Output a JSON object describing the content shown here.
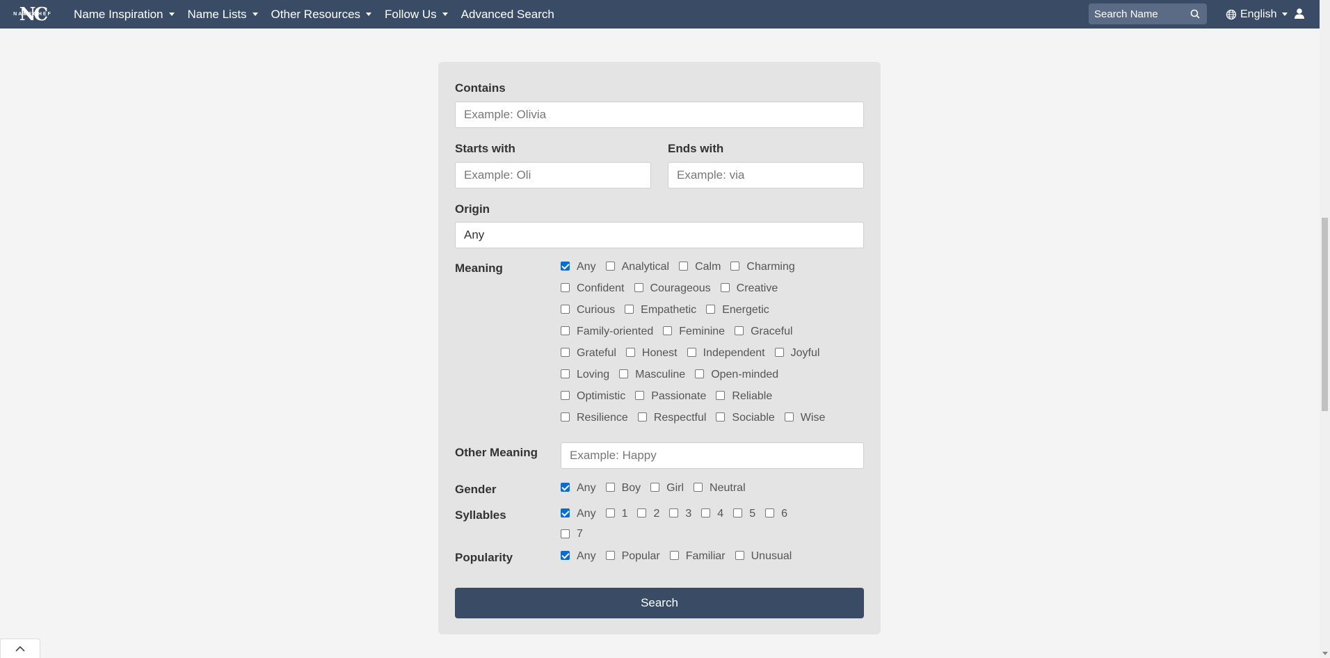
{
  "nav": {
    "logo_mark": "NC",
    "logo_word": "NAMECHEF",
    "items": [
      {
        "label": "Name Inspiration",
        "dropdown": true
      },
      {
        "label": "Name Lists",
        "dropdown": true
      },
      {
        "label": "Other Resources",
        "dropdown": true
      },
      {
        "label": "Follow Us",
        "dropdown": true
      },
      {
        "label": "Advanced Search",
        "dropdown": false
      }
    ],
    "search_placeholder": "Search Name",
    "language": "English",
    "icons": {
      "search": "search-icon",
      "language": "globe-icon",
      "user": "user-icon"
    }
  },
  "form": {
    "contains": {
      "label": "Contains",
      "placeholder": "Example: Olivia"
    },
    "starts_with": {
      "label": "Starts with",
      "placeholder": "Example: Oli"
    },
    "ends_with": {
      "label": "Ends with",
      "placeholder": "Example: via"
    },
    "origin": {
      "label": "Origin",
      "value": "Any"
    },
    "meaning": {
      "label": "Meaning",
      "rows": [
        [
          {
            "label": "Any",
            "checked": true
          },
          {
            "label": "Analytical",
            "checked": false
          },
          {
            "label": "Calm",
            "checked": false
          },
          {
            "label": "Charming",
            "checked": false
          }
        ],
        [
          {
            "label": "Confident",
            "checked": false
          },
          {
            "label": "Courageous",
            "checked": false
          },
          {
            "label": "Creative",
            "checked": false
          }
        ],
        [
          {
            "label": "Curious",
            "checked": false
          },
          {
            "label": "Empathetic",
            "checked": false
          },
          {
            "label": "Energetic",
            "checked": false
          }
        ],
        [
          {
            "label": "Family-oriented",
            "checked": false
          },
          {
            "label": "Feminine",
            "checked": false
          },
          {
            "label": "Graceful",
            "checked": false
          }
        ],
        [
          {
            "label": "Grateful",
            "checked": false
          },
          {
            "label": "Honest",
            "checked": false
          },
          {
            "label": "Independent",
            "checked": false
          },
          {
            "label": "Joyful",
            "checked": false
          }
        ],
        [
          {
            "label": "Loving",
            "checked": false
          },
          {
            "label": "Masculine",
            "checked": false
          },
          {
            "label": "Open-minded",
            "checked": false
          }
        ],
        [
          {
            "label": "Optimistic",
            "checked": false
          },
          {
            "label": "Passionate",
            "checked": false
          },
          {
            "label": "Reliable",
            "checked": false
          }
        ],
        [
          {
            "label": "Resilience",
            "checked": false
          },
          {
            "label": "Respectful",
            "checked": false
          },
          {
            "label": "Sociable",
            "checked": false
          },
          {
            "label": "Wise",
            "checked": false
          }
        ]
      ]
    },
    "other_meaning": {
      "label": "Other Meaning",
      "placeholder": "Example: Happy"
    },
    "gender": {
      "label": "Gender",
      "rows": [
        [
          {
            "label": "Any",
            "checked": true
          },
          {
            "label": "Boy",
            "checked": false
          },
          {
            "label": "Girl",
            "checked": false
          },
          {
            "label": "Neutral",
            "checked": false
          }
        ]
      ]
    },
    "syllables": {
      "label": "Syllables",
      "rows": [
        [
          {
            "label": "Any",
            "checked": true
          },
          {
            "label": "1",
            "checked": false
          },
          {
            "label": "2",
            "checked": false
          },
          {
            "label": "3",
            "checked": false
          },
          {
            "label": "4",
            "checked": false
          },
          {
            "label": "5",
            "checked": false
          },
          {
            "label": "6",
            "checked": false
          }
        ],
        [
          {
            "label": "7",
            "checked": false
          }
        ]
      ]
    },
    "popularity": {
      "label": "Popularity",
      "rows": [
        [
          {
            "label": "Any",
            "checked": true
          },
          {
            "label": "Popular",
            "checked": false
          },
          {
            "label": "Familiar",
            "checked": false
          },
          {
            "label": "Unusual",
            "checked": false
          }
        ]
      ]
    },
    "submit_label": "Search"
  },
  "colors": {
    "navbar": "#3a4b66",
    "checkbox_checked": "#0b6bcf",
    "button": "#3a4b66"
  }
}
